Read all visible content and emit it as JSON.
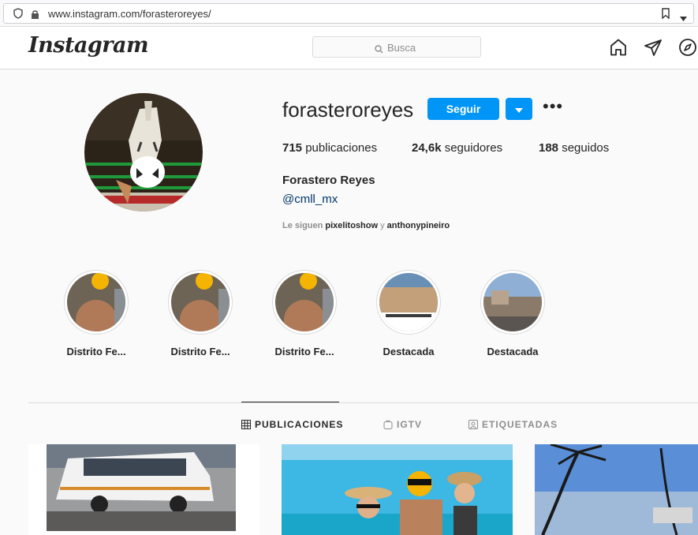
{
  "browser": {
    "url": "www.instagram.com/forasteroreyes/",
    "icons": [
      "shield-icon",
      "lock-icon",
      "bookmark-icon",
      "dropdown-icon"
    ]
  },
  "header": {
    "logo": "Instagram",
    "search_placeholder": "Busca",
    "nav_icons": [
      "home-icon",
      "direct-icon",
      "explore-icon"
    ]
  },
  "profile": {
    "username": "forasteroreyes",
    "follow_label": "Seguir",
    "more_options": "•••",
    "stats": {
      "posts_count": "715",
      "posts_label": "publicaciones",
      "followers_count": "24,6k",
      "followers_label": "seguidores",
      "following_count": "188",
      "following_label": "seguidos"
    },
    "full_name": "Forastero Reyes",
    "link": "@cmll_mx",
    "followed_by": {
      "prefix": "Le siguen",
      "user1": "pixelitoshow",
      "conj": "y",
      "user2": "anthonypineiro"
    }
  },
  "highlights": [
    {
      "label": "Distrito Fe..."
    },
    {
      "label": "Distrito Fe..."
    },
    {
      "label": "Distrito Fe..."
    },
    {
      "label": "Destacada"
    },
    {
      "label": "Destacada"
    }
  ],
  "tabs": [
    {
      "label": "PUBLICACIONES",
      "active": true
    },
    {
      "label": "IGTV",
      "active": false
    },
    {
      "label": "ETIQUETADAS",
      "active": false
    }
  ],
  "colors": {
    "accent": "#0095f6",
    "link": "#00376b",
    "text": "#262626",
    "muted": "#8e8e8e"
  }
}
